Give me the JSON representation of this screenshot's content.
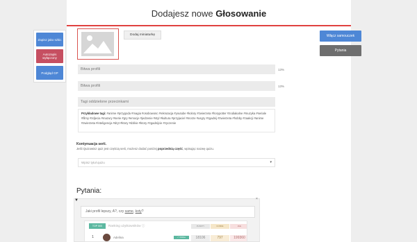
{
  "header": {
    "title_prefix": "Dodajesz nowe ",
    "title_bold": "Głosowanie"
  },
  "sidebar": {
    "save_label": "Zapisz jako szkic",
    "autosave_label": "Autozapis wyłączony",
    "preview_label": "Podgląd GP"
  },
  "thumbnail": {
    "add_label": "Dodaj miniaturkę"
  },
  "fields": {
    "title1_placeholder": "Bitwa profili",
    "title1_counter": "13%",
    "title2_placeholder": "Bitwa profili",
    "title2_counter": "13%",
    "tags_placeholder": "Tagi oddzielone przecinkami"
  },
  "tags_examples": {
    "label": "Przykładowe tagi:",
    "text": "#anime #przygoda #magia #osobowosc #rekrutacja #youtube #kolory #zwierzeta #horypotter #zodiakalne #muzyka #seriale #filmy #zdjecia #mazury #serie #gry #emocje #jedzenie #styl #kultura #przyjaciel #morze #usgry #zgadnij #zwierzeta #hobby #zaakcji #anime #zwierzeta #inteligencja #dryt #ktory #dzikie #ktory #zgadnijcie #zyczenie"
  },
  "series": {
    "title": "Kontynuacja serii.",
    "desc_prefix": "Jeśli Quizowisz quiz jest częścią serii, możesz dodać poniżej ",
    "desc_bold": "poprzednią część",
    "desc_suffix": ", wpisując nazwę quizu.",
    "select_placeholder": "Wpisz tytuł quizu"
  },
  "questions": {
    "title": "Pytania:",
    "toggle_icon": "triangle-down-icon",
    "close_icon": "close-icon",
    "q1_prefix": "Jaki profil lepszy, A?, czy ",
    "q1_u1": "same",
    "q1_mid": ", ",
    "q1_u2": "koty",
    "q1_suffix": "?",
    "ranking": {
      "tab": "TOP 500",
      "title": "Ranking użytkowników",
      "title_icon": "help-icon",
      "col1": "PUNKTY",
      "col2": "DOBRE",
      "col3": "ZŁE",
      "row_num": "1",
      "row_name": "Adelina",
      "row_badge": "✓ Online",
      "row_v1": "18106",
      "row_v2": "797",
      "row_v3": "199360"
    }
  },
  "actions": {
    "enable_label": "Włącz samouczek",
    "questions_label": "Pytania",
    "accent_color": "#e0413f"
  }
}
